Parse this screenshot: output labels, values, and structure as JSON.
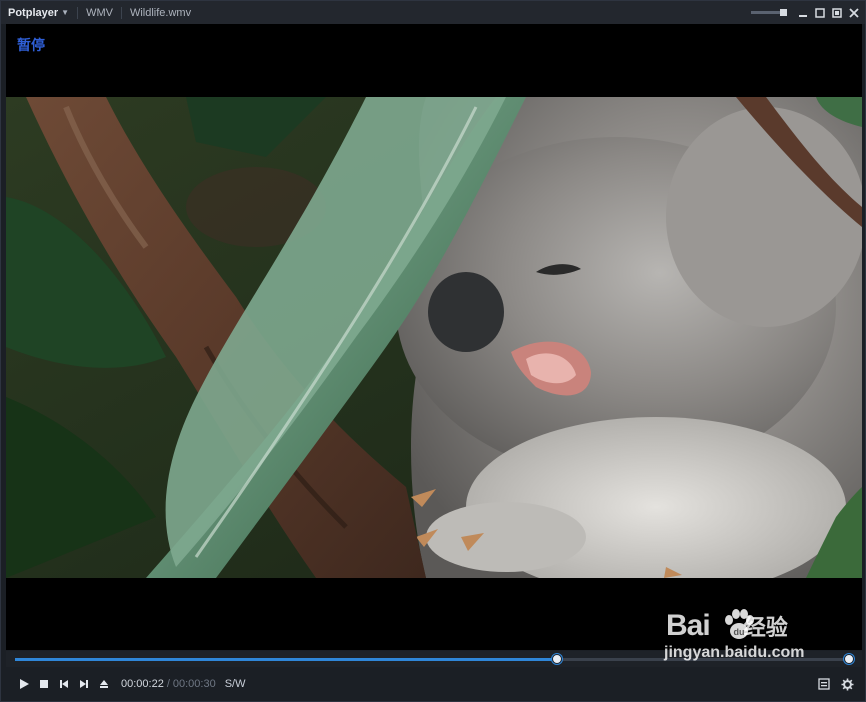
{
  "titlebar": {
    "app_name": "Potplayer",
    "format": "WMV",
    "file_name": "Wildlife.wmv"
  },
  "video": {
    "osd_text": "暂停"
  },
  "playback": {
    "current_time": "00:00:22",
    "separator": "/",
    "total_time": "00:00:30",
    "mode": "S/W",
    "progress_fraction": 0.65,
    "volume_fraction": 1.0
  },
  "watermark": {
    "brand": "Bai",
    "brand_cn": "经验",
    "url": "jingyan.baidu.com"
  },
  "icons": {
    "play": "play-icon",
    "stop": "stop-icon",
    "prev": "previous-icon",
    "next": "next-icon",
    "eject": "eject-icon",
    "playlist": "playlist-icon",
    "settings": "gear-icon"
  },
  "colors": {
    "accent": "#2f86d8",
    "osd": "#2f5fd6"
  }
}
